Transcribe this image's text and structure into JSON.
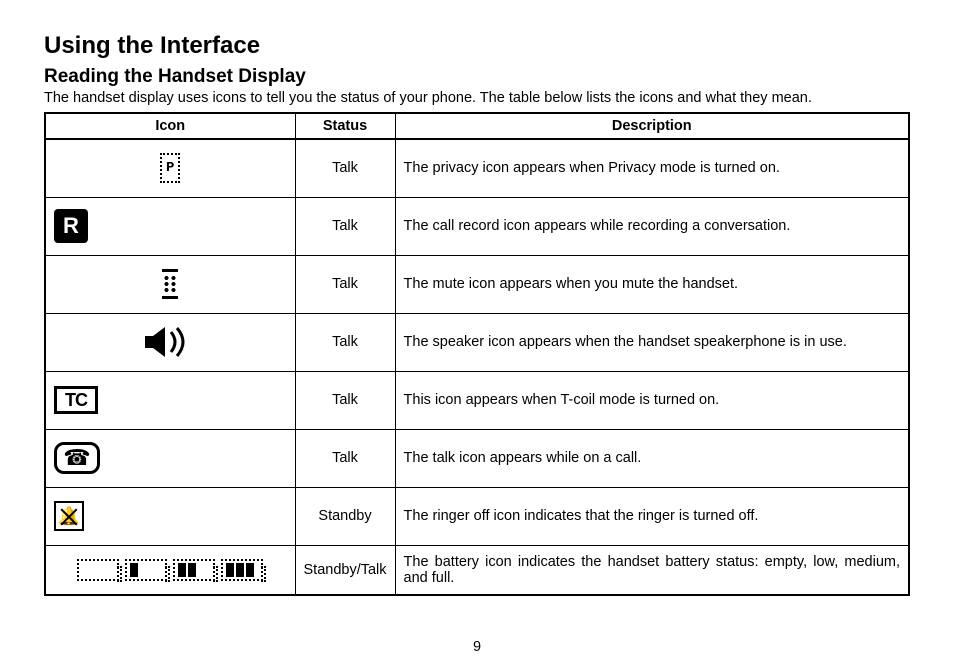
{
  "title": "Using the Interface",
  "subtitle": "Reading the Handset Display",
  "intro": "The handset display uses icons to tell you the status of your phone. The table below lists the icons and what they mean.",
  "page_number": "9",
  "table": {
    "headers": {
      "icon": "Icon",
      "status": "Status",
      "description": "Description"
    },
    "rows": [
      {
        "icon_name": "privacy-icon",
        "status": "Talk",
        "description": "The privacy icon appears when Privacy mode is turned on."
      },
      {
        "icon_name": "record-icon",
        "status": "Talk",
        "description": "The call record icon appears while recording a conversation."
      },
      {
        "icon_name": "mute-icon",
        "status": "Talk",
        "description": "The mute icon appears when you mute the handset."
      },
      {
        "icon_name": "speaker-icon",
        "status": "Talk",
        "description": "The speaker icon appears when the handset speakerphone is in use."
      },
      {
        "icon_name": "tcoil-icon",
        "status": "Talk",
        "description": "This icon appears when T-coil mode is turned on."
      },
      {
        "icon_name": "talk-icon",
        "status": "Talk",
        "description": "The talk icon appears while on a call."
      },
      {
        "icon_name": "ringer-off-icon",
        "status": "Standby",
        "description": "The ringer off icon indicates that the ringer is turned off."
      },
      {
        "icon_name": "battery-icon",
        "status": "Standby/Talk",
        "description": "The battery icon indicates the handset battery status: empty, low, medium, and full."
      }
    ]
  },
  "icon_labels": {
    "record_letter": "R",
    "tc_letters": "TC"
  }
}
